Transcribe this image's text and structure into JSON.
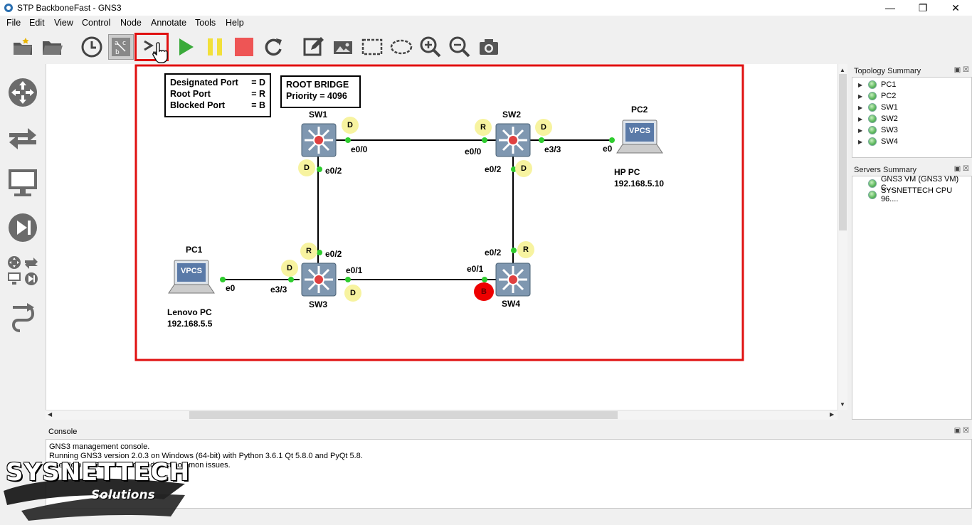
{
  "window": {
    "title": "STP BackboneFast - GNS3"
  },
  "menu": [
    "File",
    "Edit",
    "View",
    "Control",
    "Node",
    "Annotate",
    "Tools",
    "Help"
  ],
  "legend": {
    "rows": [
      {
        "label": "Designated Port",
        "value": "= D"
      },
      {
        "label": "Root Port",
        "value": "= R"
      },
      {
        "label": "Blocked Port",
        "value": "= B"
      }
    ]
  },
  "root_bridge": {
    "line1": "ROOT BRIDGE",
    "line2": "Priority = 4096"
  },
  "nodes": {
    "sw1": "SW1",
    "sw2": "SW2",
    "sw3": "SW3",
    "sw4": "SW4",
    "pc1": "PC1",
    "pc2": "PC2",
    "pc1_desc": "Lenovo PC",
    "pc1_ip": "192.168.5.5",
    "pc2_desc": "HP PC",
    "pc2_ip": "192.168.5.10",
    "vpcs_label": "VPCS"
  },
  "ports": {
    "sw1_e00": "e0/0",
    "sw1_e02": "e0/2",
    "sw2_e00": "e0/0",
    "sw2_e33": "e3/3",
    "sw2_e02": "e0/2",
    "pc2_e0": "e0",
    "sw3_e02": "e0/2",
    "sw3_e01": "e0/1",
    "sw3_e33": "e3/3",
    "pc1_e0": "e0",
    "sw4_e02": "e0/2",
    "sw4_e01": "e0/1"
  },
  "roles": {
    "sw1_e00": "D",
    "sw1_e02": "D",
    "sw2_e00": "R",
    "sw2_e33": "D",
    "sw2_e02": "D",
    "sw3_e02": "R",
    "sw3_e33": "D",
    "sw3_e01": "D",
    "sw4_e02": "R",
    "sw4_e01": "B"
  },
  "topology_summary": {
    "title": "Topology Summary",
    "items": [
      "PC1",
      "PC2",
      "SW1",
      "SW2",
      "SW3",
      "SW4"
    ]
  },
  "servers_summary": {
    "title": "Servers Summary",
    "items": [
      "GNS3 VM (GNS3 VM) C...",
      "SYSNETTECH CPU 96...."
    ]
  },
  "console": {
    "title": "Console",
    "lines": [
      "GNS3 management console.",
      "Running GNS3 version 2.0.3 on Windows (64-bit) with Python 3.6.1 Qt 5.8.0 and PyQt 5.8.",
      "Use Help -> GNS3 Doctor to detect common issues."
    ]
  },
  "watermark": {
    "brand": "SYSNETTECH",
    "sub": "Solutions"
  },
  "colors": {
    "highlight_red": "#e01010",
    "link_green": "#2ecc2e",
    "badge_yellow": "#f7f3a0",
    "blocked_red": "#e00000"
  }
}
